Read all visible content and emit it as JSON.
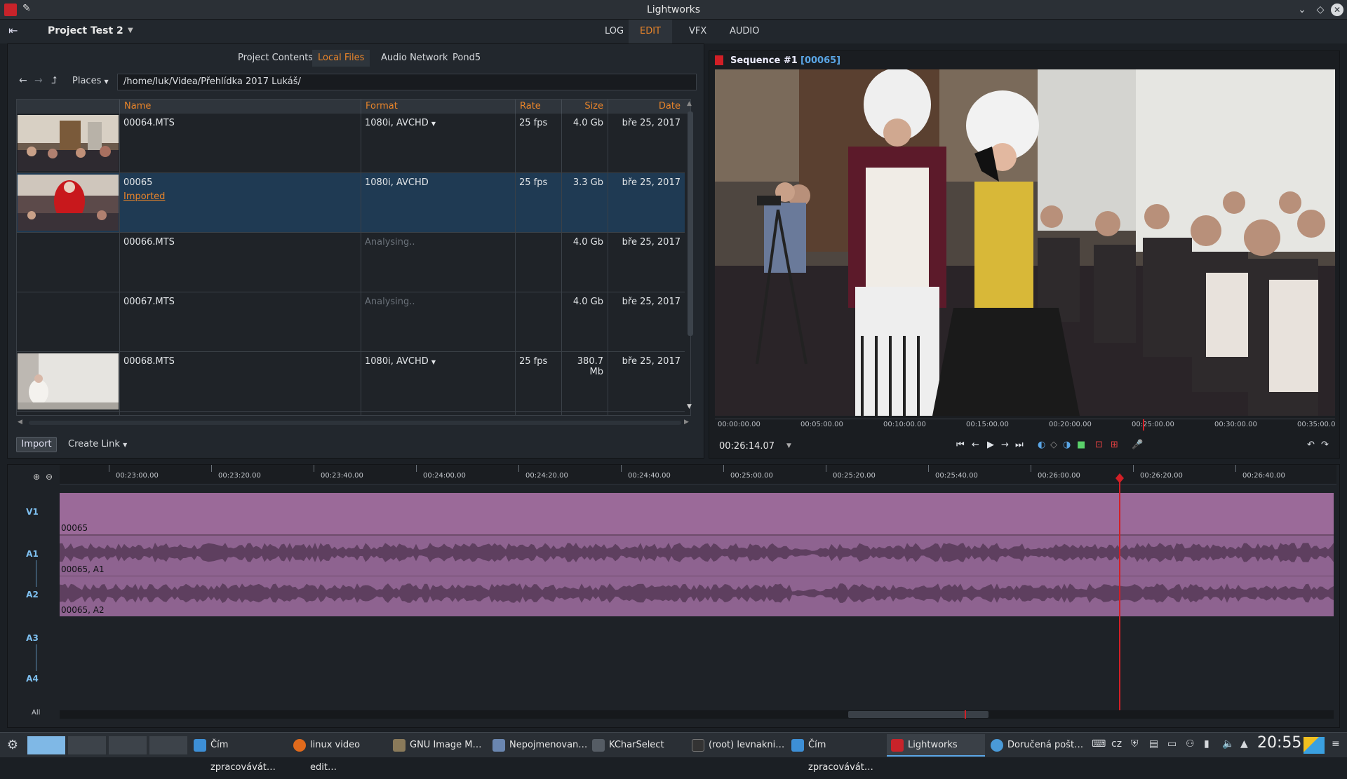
{
  "window": {
    "title": "Lightworks"
  },
  "topbar": {
    "project": "Project Test 2",
    "tabs": [
      {
        "label": "LOG",
        "active": false
      },
      {
        "label": "EDIT",
        "active": true
      },
      {
        "label": "VFX",
        "active": false
      },
      {
        "label": "AUDIO",
        "active": false
      }
    ]
  },
  "browser": {
    "tabs": [
      {
        "label": "Project Contents",
        "active": false
      },
      {
        "label": "Local Files",
        "active": true
      },
      {
        "label": "Audio Network",
        "active": false
      },
      {
        "label": "Pond5",
        "active": false
      }
    ],
    "places_label": "Places",
    "path": "/home/luk/Videa/Přehlídka 2017 Lukáš/",
    "columns": [
      "Name",
      "Format",
      "Rate",
      "Size",
      "Date"
    ],
    "rows": [
      {
        "name": "00064.MTS",
        "format": "1080i, AVCHD",
        "rate": "25 fps",
        "size": "4.0 Gb",
        "date": "bře 25, 2017",
        "status": ""
      },
      {
        "name": "00065",
        "format": "1080i, AVCHD",
        "rate": "25 fps",
        "size": "3.3 Gb",
        "date": "bře 25, 2017",
        "status": "Imported"
      },
      {
        "name": "00066.MTS",
        "format": "Analysing..",
        "rate": "",
        "size": "4.0 Gb",
        "date": "bře 25, 2017",
        "status": ""
      },
      {
        "name": "00067.MTS",
        "format": "Analysing..",
        "rate": "",
        "size": "4.0 Gb",
        "date": "bře 25, 2017",
        "status": ""
      },
      {
        "name": "00068.MTS",
        "format": "1080i, AVCHD",
        "rate": "25 fps",
        "size": "380.7 Mb",
        "date": "bře 25, 2017",
        "status": ""
      }
    ],
    "import_label": "Import",
    "create_link_label": "Create Link"
  },
  "viewer": {
    "sequence_title": "Sequence #1",
    "sequence_id": "[00065]",
    "ruler": [
      "00:00:00.00",
      "00:05:00.00",
      "00:10:00.00",
      "00:15:00.00",
      "00:20:00.00",
      "00:25:00.00",
      "00:30:00.00",
      "00:35:00.0"
    ],
    "timecode": "00:26:14.07"
  },
  "timeline": {
    "ruler": [
      "00:23:00.00",
      "00:23:20.00",
      "00:23:40.00",
      "00:24:00.00",
      "00:24:20.00",
      "00:24:40.00",
      "00:25:00.00",
      "00:25:20.00",
      "00:25:40.00",
      "00:26:00.00",
      "00:26:20.00",
      "00:26:40.00"
    ],
    "tracks": [
      "V1",
      "A1",
      "A2",
      "A3",
      "A4"
    ],
    "clips": {
      "v1": "00065",
      "a1": "00065, A1",
      "a2": "00065, A2"
    },
    "all_label": "All"
  },
  "taskbar": {
    "tasks": [
      {
        "label": "Čím zpracovávát…",
        "color": "#3d8fd6"
      },
      {
        "label": "linux video edit…",
        "color": "#e06a1c"
      },
      {
        "label": "GNU Image M…",
        "color": "#8a7a5a"
      },
      {
        "label": "Nepojmenovan…",
        "color": "#6a86b0"
      },
      {
        "label": "KCharSelect",
        "color": "#555c64"
      },
      {
        "label": "(root) levnakni…",
        "color": "#333"
      },
      {
        "label": "Čím zpracovávát…",
        "color": "#3d8fd6"
      },
      {
        "label": "Lightworks",
        "color": "#c8232a"
      },
      {
        "label": "Doručená pošt…",
        "color": "#4a9ad8"
      }
    ],
    "lang": "cz",
    "clock": "20:55"
  }
}
